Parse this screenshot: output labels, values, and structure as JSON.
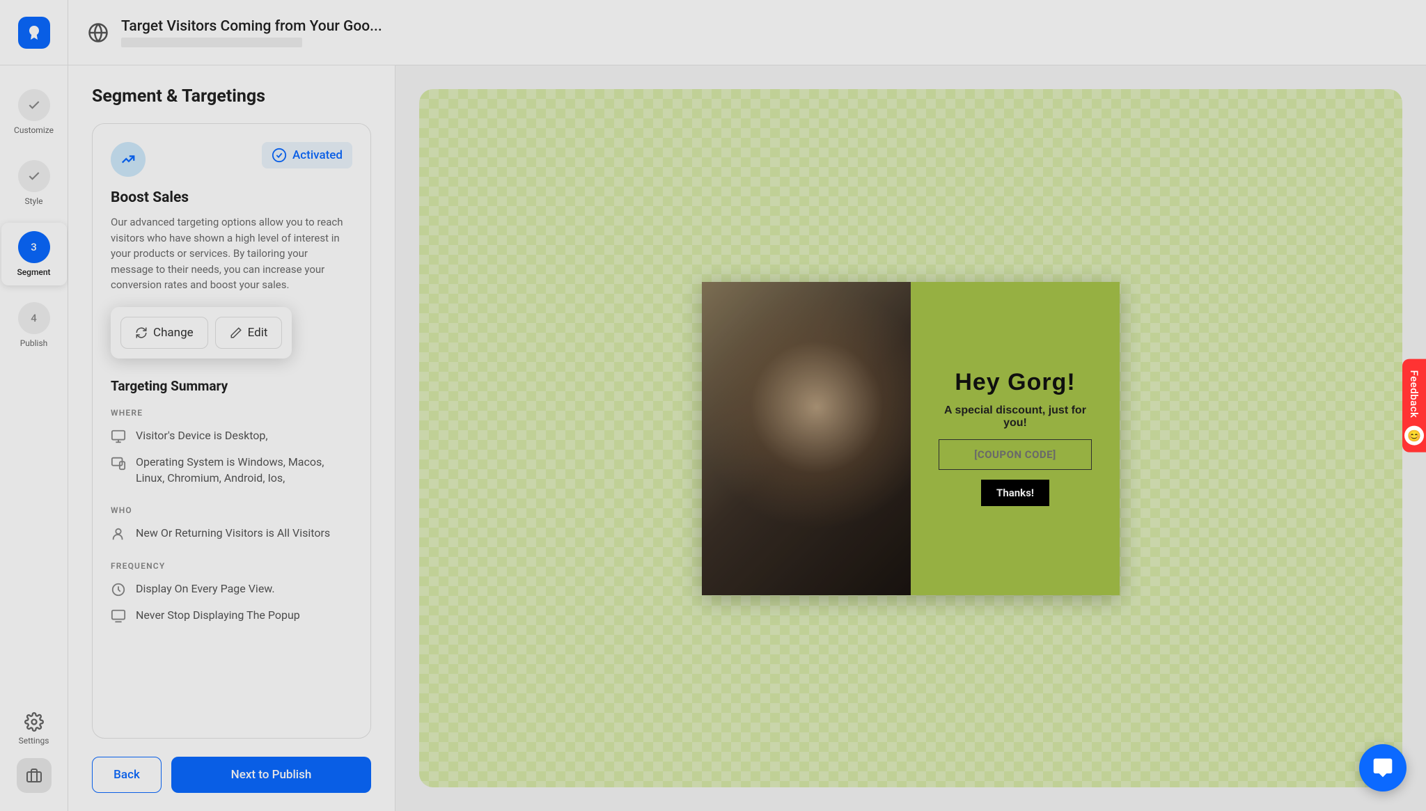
{
  "header": {
    "title": "Target Visitors Coming from Your Goo..."
  },
  "nav": {
    "customize": "Customize",
    "style": "Style",
    "segment_num": "3",
    "segment": "Segment",
    "publish_num": "4",
    "publish": "Publish",
    "settings": "Settings"
  },
  "panel": {
    "title": "Segment & Targetings",
    "activated": "Activated",
    "card_title": "Boost Sales",
    "card_desc": "Our advanced targeting options allow you to reach visitors who have shown a high level of interest in your products or services. By tailoring your message to their needs, you can increase your conversion rates and boost your sales.",
    "change": "Change",
    "edit": "Edit",
    "summary_title": "Targeting Summary",
    "where": "WHERE",
    "where_rows": [
      "Visitor's Device is Desktop,",
      "Operating System is Windows, Macos, Linux, Chromium, Android, Ios,"
    ],
    "who": "WHO",
    "who_rows": [
      "New Or Returning Visitors is All Visitors"
    ],
    "frequency": "FREQUENCY",
    "frequency_rows": [
      "Display On Every Page View.",
      "Never Stop Displaying The Popup"
    ],
    "back": "Back",
    "next": "Next to Publish"
  },
  "popup": {
    "heading": "Hey Gorg!",
    "sub": "A special discount, just for you!",
    "coupon_placeholder": "[COUPON CODE]",
    "thanks": "Thanks!"
  },
  "feedback": {
    "label": "Feedback"
  }
}
